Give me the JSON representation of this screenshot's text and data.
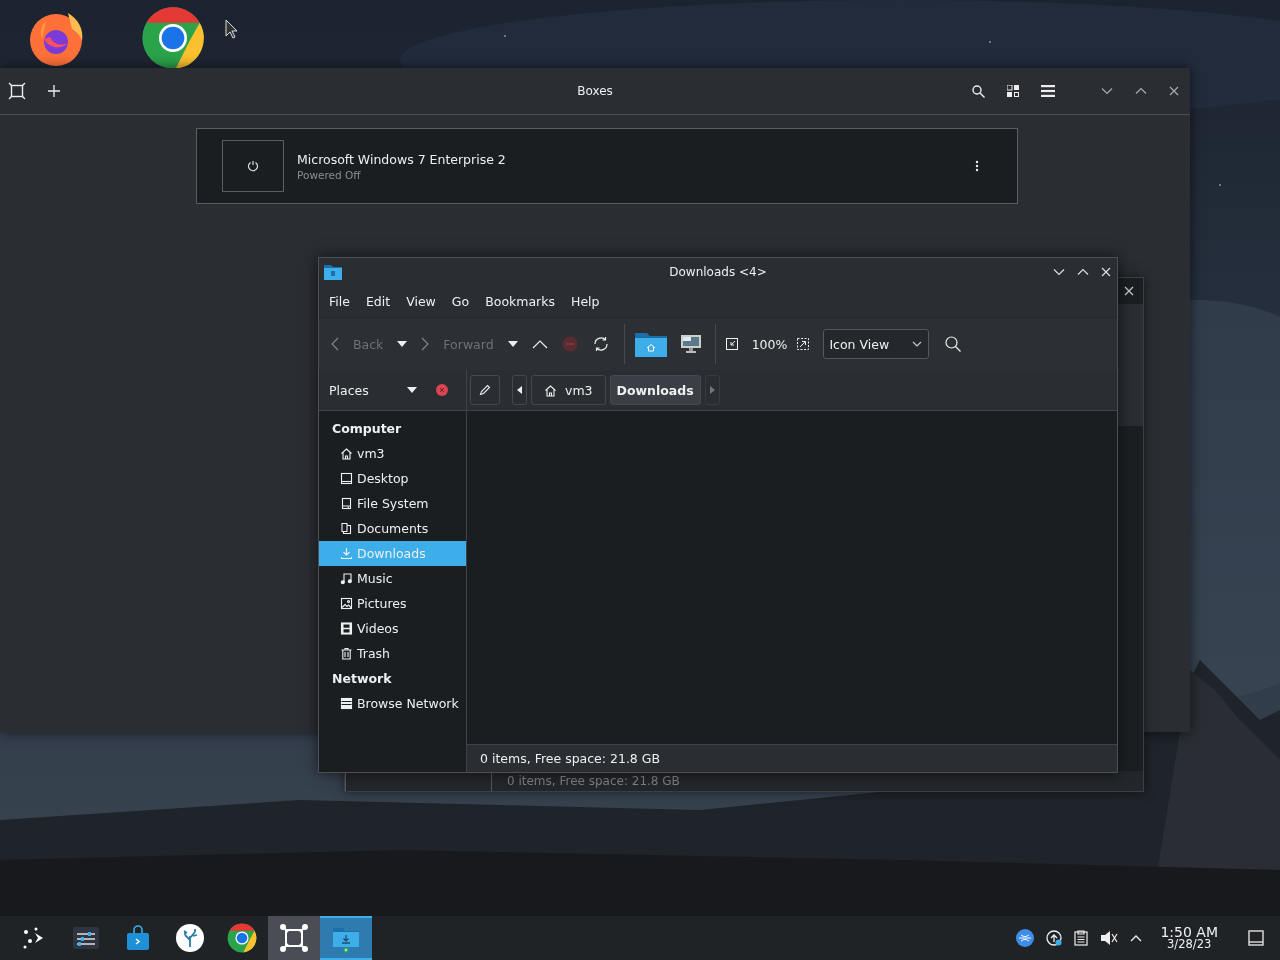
{
  "boxes_window": {
    "title": "Boxes",
    "machines": [
      {
        "name": "Microsoft Windows 7 Enterprise 2",
        "status": "Powered Off"
      }
    ]
  },
  "background_window": {
    "status_bar": "0 items, Free space: 21.8 GB"
  },
  "file_manager": {
    "title": "Downloads <4>",
    "menu": [
      "File",
      "Edit",
      "View",
      "Go",
      "Bookmarks",
      "Help"
    ],
    "toolbar": {
      "back": {
        "label": "Back",
        "disabled": true
      },
      "forward": {
        "label": "Forward",
        "disabled": true
      },
      "zoom": "100%",
      "view_mode": "Icon View"
    },
    "side_pane": "Places",
    "breadcrumbs": [
      {
        "label": "vm3",
        "kind": "home",
        "selected": false
      },
      {
        "label": "Downloads",
        "kind": "folder",
        "selected": true
      }
    ],
    "sidebar": [
      {
        "heading": "Computer",
        "items": [
          {
            "label": "vm3",
            "kind": "home",
            "selected": false
          },
          {
            "label": "Desktop",
            "kind": "desktop",
            "selected": false
          },
          {
            "label": "File System",
            "kind": "drive",
            "selected": false
          },
          {
            "label": "Documents",
            "kind": "documents",
            "selected": false
          },
          {
            "label": "Downloads",
            "kind": "download",
            "selected": true
          },
          {
            "label": "Music",
            "kind": "music",
            "selected": false
          },
          {
            "label": "Pictures",
            "kind": "pictures",
            "selected": false
          },
          {
            "label": "Videos",
            "kind": "videos",
            "selected": false
          },
          {
            "label": "Trash",
            "kind": "trash",
            "selected": false
          }
        ]
      },
      {
        "heading": "Network",
        "items": [
          {
            "label": "Browse Network",
            "kind": "network",
            "selected": false
          }
        ]
      }
    ],
    "status_bar": "0 items, Free space: 21.8 GB"
  },
  "taskbar": {
    "tasks": [
      {
        "kind": "launcher",
        "running": false,
        "selected": false
      },
      {
        "kind": "settings",
        "running": false,
        "selected": false
      },
      {
        "kind": "store",
        "running": false,
        "selected": false
      },
      {
        "kind": "discover",
        "running": false,
        "selected": false
      },
      {
        "kind": "chrome",
        "running": false,
        "selected": false
      },
      {
        "kind": "boxes",
        "running": true,
        "selected": false
      },
      {
        "kind": "files",
        "running": true,
        "selected": true
      }
    ],
    "time": "1:50 AM",
    "date": "3/28/23"
  }
}
